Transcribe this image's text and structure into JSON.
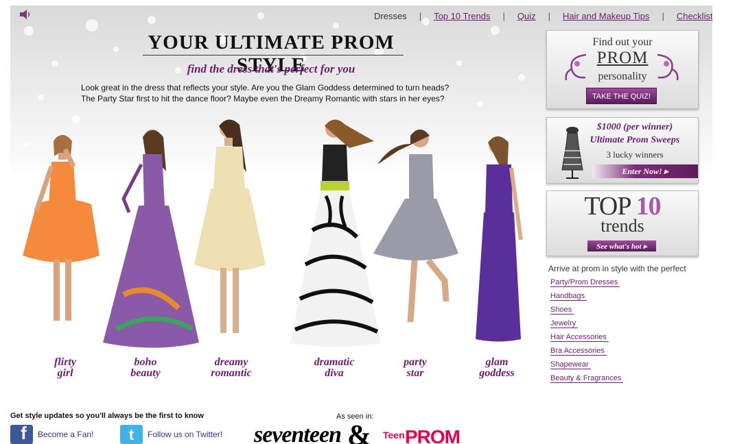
{
  "nav": {
    "items": [
      {
        "label": "Dresses",
        "link": false
      },
      {
        "label": "Top 10 Trends",
        "link": true
      },
      {
        "label": "Quiz",
        "link": true
      },
      {
        "label": "Hair and Makeup Tips",
        "link": true
      },
      {
        "label": "Checklist",
        "link": true
      }
    ],
    "separator": "|"
  },
  "hero": {
    "title": "YOUR ULTIMATE PROM STYLE",
    "subtitle": "find the dress that's perfect for you",
    "intro_line1": "Look great in the dress that reflects your style. Are you the Glam Goddess determined to turn heads?",
    "intro_line2": "The Party Star first to hit the dance floor? Maybe even the Dreamy Romantic with stars in her eyes?"
  },
  "styles": [
    {
      "line1": "flirty",
      "line2": "girl",
      "dress_color": "#f58a3c"
    },
    {
      "line1": "boho",
      "line2": "beauty",
      "dress_color": "#8a5aa8"
    },
    {
      "line1": "dreamy",
      "line2": "romantic",
      "dress_color": "#efe0b4"
    },
    {
      "line1": "dramatic",
      "line2": "diva",
      "dress_color": "#222222"
    },
    {
      "line1": "party",
      "line2": "star",
      "dress_color": "#9a9aa8"
    },
    {
      "line1": "glam",
      "line2": "goddess",
      "dress_color": "#5b2f9b"
    }
  ],
  "promos": {
    "quiz": {
      "line1": "Find out your",
      "line2": "PROM",
      "line3": "personality",
      "button": "TAKE THE QUIZ!"
    },
    "sweeps": {
      "line1": "$1000 (per winner)",
      "line2": "Ultimate Prom Sweeps",
      "line3": "3 lucky winners",
      "button": "Enter Now! ▸"
    },
    "trends": {
      "top": "TOP",
      "num": "10",
      "word": "trends",
      "button": "See what's hot ▸"
    }
  },
  "shop": {
    "intro": "Arrive at prom in style with the perfect",
    "links": [
      "Party/Prom Dresses",
      "Handbags",
      "Shoes",
      "Jewelry",
      "Hair Accessories",
      "Bra Accessories",
      "Shapewear",
      "Beauty & Fragrances"
    ]
  },
  "footer": {
    "heading": "Get style updates so you'll always be the first to know",
    "facebook_label": "Become a Fan!",
    "facebook_glyph": "f",
    "twitter_label": "Follow us on Twitter!",
    "twitter_glyph": "t",
    "seen_in": "As seen in:",
    "seventeen": "seventeen",
    "amp": "&",
    "teen": "Teen",
    "prom": "PROM"
  },
  "colors": {
    "accent": "#6b1e6e",
    "brand_pink": "#e8004e"
  },
  "icons": [
    "speaker-icon",
    "facebook-icon",
    "twitter-icon",
    "dress-form-icon",
    "swirl-ornament-icon"
  ]
}
